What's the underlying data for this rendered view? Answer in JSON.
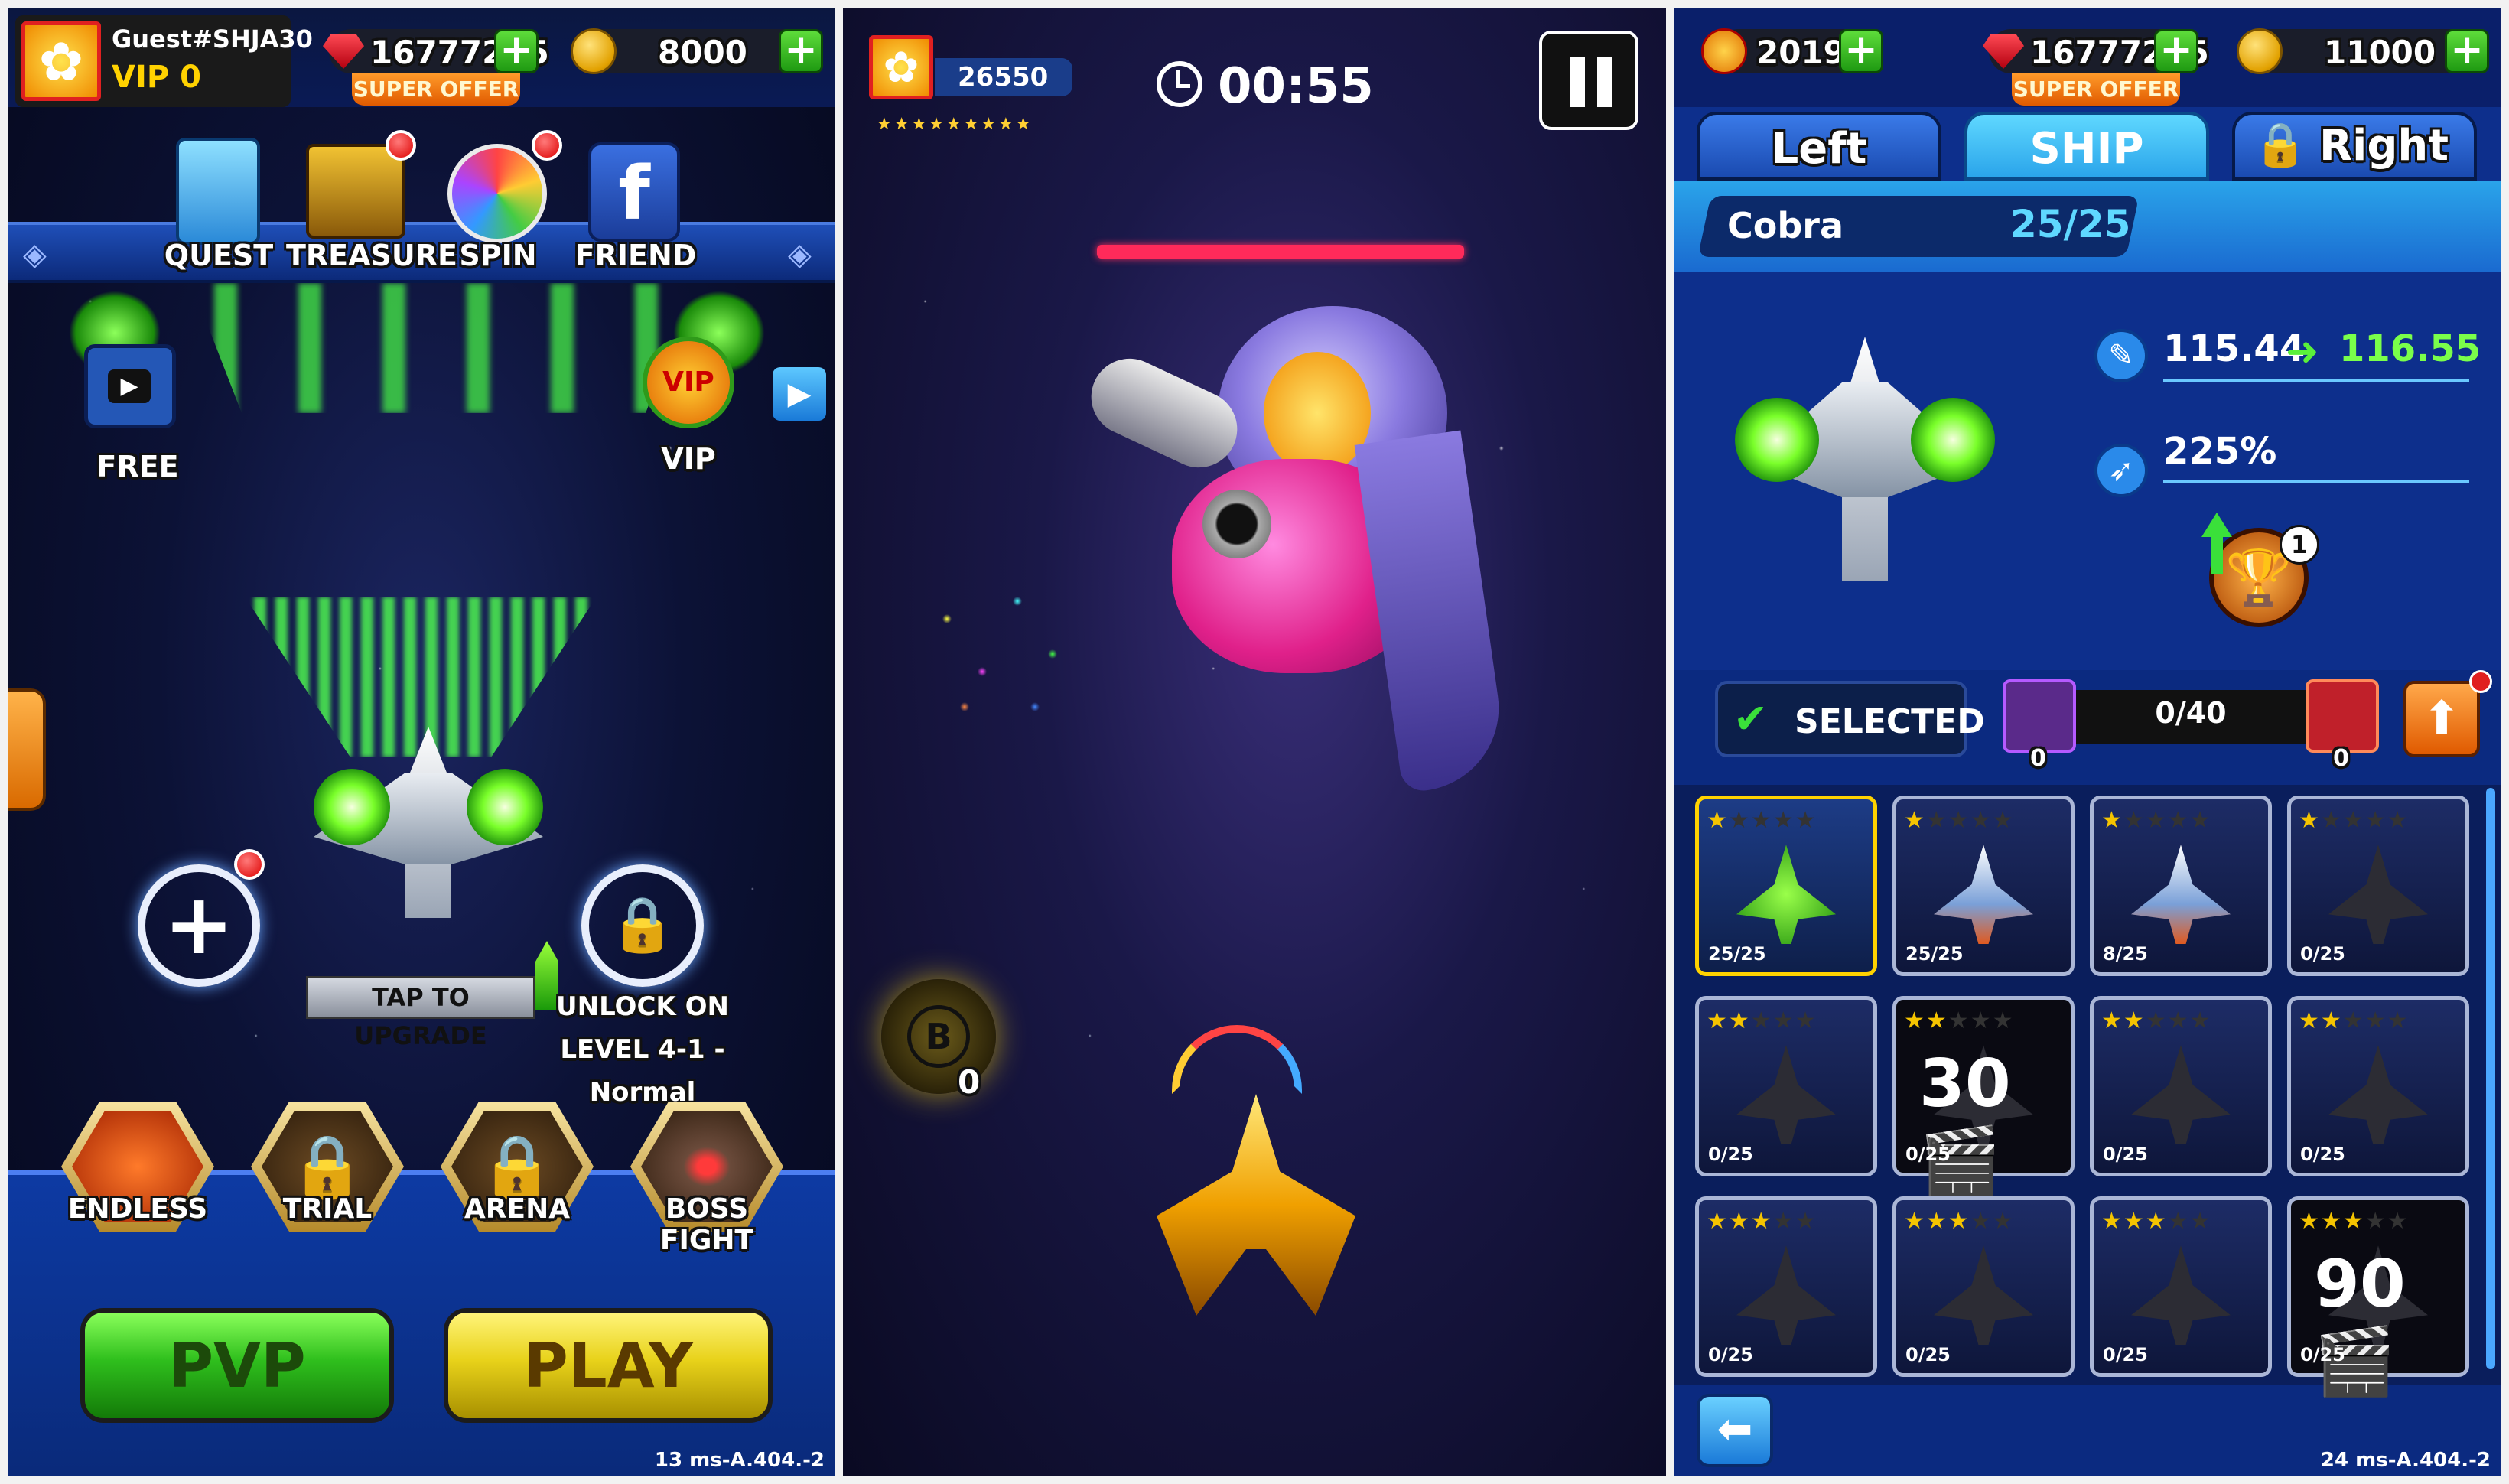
{
  "panel1": {
    "player": {
      "name": "Guest#SHJA30",
      "vip": "VIP 0"
    },
    "currency": {
      "gems": "16777215",
      "super_offer": "SUPER OFFER",
      "coins": "8000"
    },
    "top_menu": [
      {
        "label": "QUEST",
        "icon": "quest-clipboard-icon"
      },
      {
        "label": "TREASURE",
        "icon": "treasure-chest-icon"
      },
      {
        "label": "SPIN",
        "icon": "spin-wheel-icon"
      },
      {
        "label": "FRIEND",
        "icon": "facebook-icon"
      }
    ],
    "free_label": "FREE",
    "vip_label": "VIP",
    "vip_badge_text": "VIP",
    "upgrade_label": "TAP TO UPGRADE",
    "unlock_text": [
      "UNLOCK ON",
      "LEVEL 4-1 -",
      "Normal"
    ],
    "modes": [
      {
        "label": "ENDLESS",
        "locked": false
      },
      {
        "label": "TRIAL",
        "locked": true
      },
      {
        "label": "ARENA",
        "locked": true
      },
      {
        "label": "BOSS FIGHT",
        "locked": false
      }
    ],
    "pvp_label": "PVP",
    "play_label": "PLAY",
    "version": "13 ms-A.404.-2"
  },
  "panel2": {
    "score": "26550",
    "timer": "00:55",
    "bomb_letter": "B",
    "bomb_count": "0"
  },
  "panel3": {
    "currency": {
      "medals": "2019",
      "gems": "16777215",
      "super_offer": "SUPER OFFER",
      "coins": "11000"
    },
    "tabs": [
      {
        "label": "Left",
        "active": false,
        "locked": false
      },
      {
        "label": "SHIP",
        "active": true,
        "locked": false
      },
      {
        "label": "Right",
        "active": false,
        "locked": true
      }
    ],
    "ship_name": "Cobra",
    "ship_level": "25/25",
    "stats": {
      "power_from": "115.44",
      "power_to": "116.55",
      "speed": "225%"
    },
    "trophy_badge": "1",
    "selected_label": "SELECTED",
    "shard_count": "0",
    "progress": "0/40",
    "ticket_count": "0",
    "grid": [
      {
        "stars": 1,
        "count": "25/25",
        "selected": true,
        "unlocked": true
      },
      {
        "stars": 1,
        "count": "25/25",
        "selected": false,
        "unlocked": true
      },
      {
        "stars": 1,
        "count": "8/25",
        "selected": false,
        "unlocked": true
      },
      {
        "stars": 1,
        "count": "0/25",
        "selected": false,
        "unlocked": false
      },
      {
        "stars": 2,
        "count": "0/25",
        "selected": false,
        "unlocked": false
      },
      {
        "stars": 2,
        "count": "0/25",
        "selected": false,
        "unlocked": false,
        "ad": "30"
      },
      {
        "stars": 2,
        "count": "0/25",
        "selected": false,
        "unlocked": false
      },
      {
        "stars": 2,
        "count": "0/25",
        "selected": false,
        "unlocked": false
      },
      {
        "stars": 3,
        "count": "0/25",
        "selected": false,
        "unlocked": false
      },
      {
        "stars": 3,
        "count": "0/25",
        "selected": false,
        "unlocked": false
      },
      {
        "stars": 3,
        "count": "0/25",
        "selected": false,
        "unlocked": false
      },
      {
        "stars": 3,
        "count": "0/25",
        "selected": false,
        "unlocked": false,
        "ad": "90"
      }
    ],
    "version": "24 ms-A.404.-2"
  },
  "colors": {
    "gem_red": "#e0192b",
    "coin_gold": "#f2b800",
    "plus_green": "#2fbf1d",
    "play_yellow": "#e8d21a",
    "pvp_green": "#37c21d",
    "panel_blue": "#0d2f8c"
  }
}
